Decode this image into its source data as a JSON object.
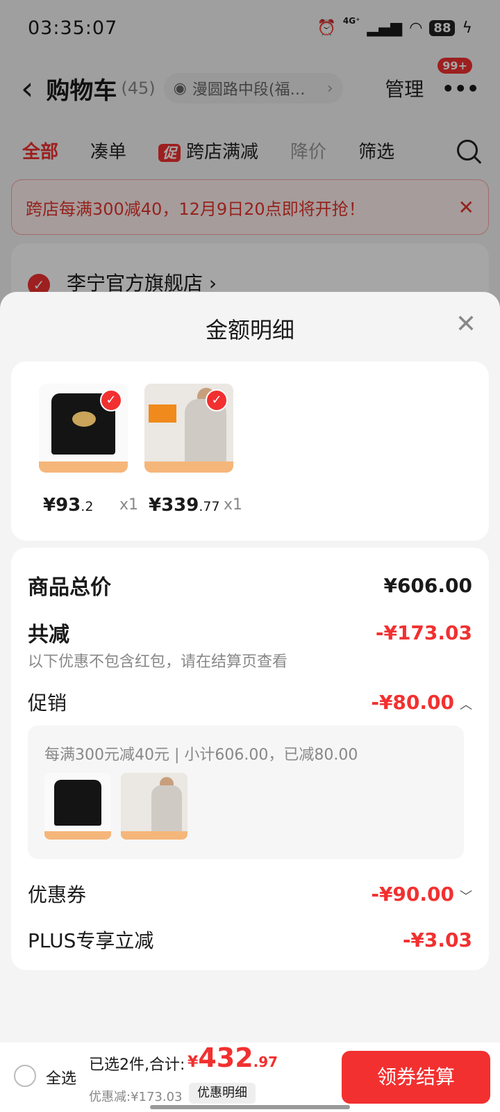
{
  "status_bar": {
    "time": "03:35:07",
    "network": "4G⁺",
    "battery": "88"
  },
  "header": {
    "title": "购物车",
    "count": "(45)",
    "address": "漫圆路中段(福…",
    "manage": "管理",
    "message_badge": "99+"
  },
  "tabs": {
    "all": "全部",
    "bundle": "凑单",
    "promo_badge": "促",
    "cross_store": "跨店满减",
    "price_drop": "降价",
    "filter": "筛选"
  },
  "notice": {
    "text": "跨店每满300减40，12月9日20点即将开抢！"
  },
  "shop": {
    "name": "李宁官方旗舰店 ›"
  },
  "sheet": {
    "title": "金额明细",
    "products": [
      {
        "price_int": "¥93",
        "price_dec": ".2",
        "qty": "x1"
      },
      {
        "price_int": "¥339",
        "price_dec": ".77",
        "qty": "x1"
      }
    ],
    "subtotal_label": "商品总价",
    "subtotal_value": "¥606.00",
    "total_off_label": "共减",
    "total_off_value": "-¥173.03",
    "total_off_note": "以下优惠不包含红包，请在结算页查看",
    "promo_label": "促销",
    "promo_value": "-¥80.00",
    "promo_note": "每满300元减40元 | 小计606.00，已减80.00",
    "coupon_label": "优惠券",
    "coupon_value": "-¥90.00",
    "plus_label": "PLUS专享立减",
    "plus_value": "-¥3.03"
  },
  "bottom_bar": {
    "select_all": "全选",
    "selected_text": "已选2件,合计:",
    "total_symbol": "¥",
    "total_int": "432",
    "total_dec": ".97",
    "discount_text": "优惠减:¥173.03",
    "detail_button": "优惠明细",
    "checkout": "领券结算"
  },
  "colors": {
    "accent": "#f23030",
    "overlay": "rgba(0,0,0,0.35)"
  }
}
